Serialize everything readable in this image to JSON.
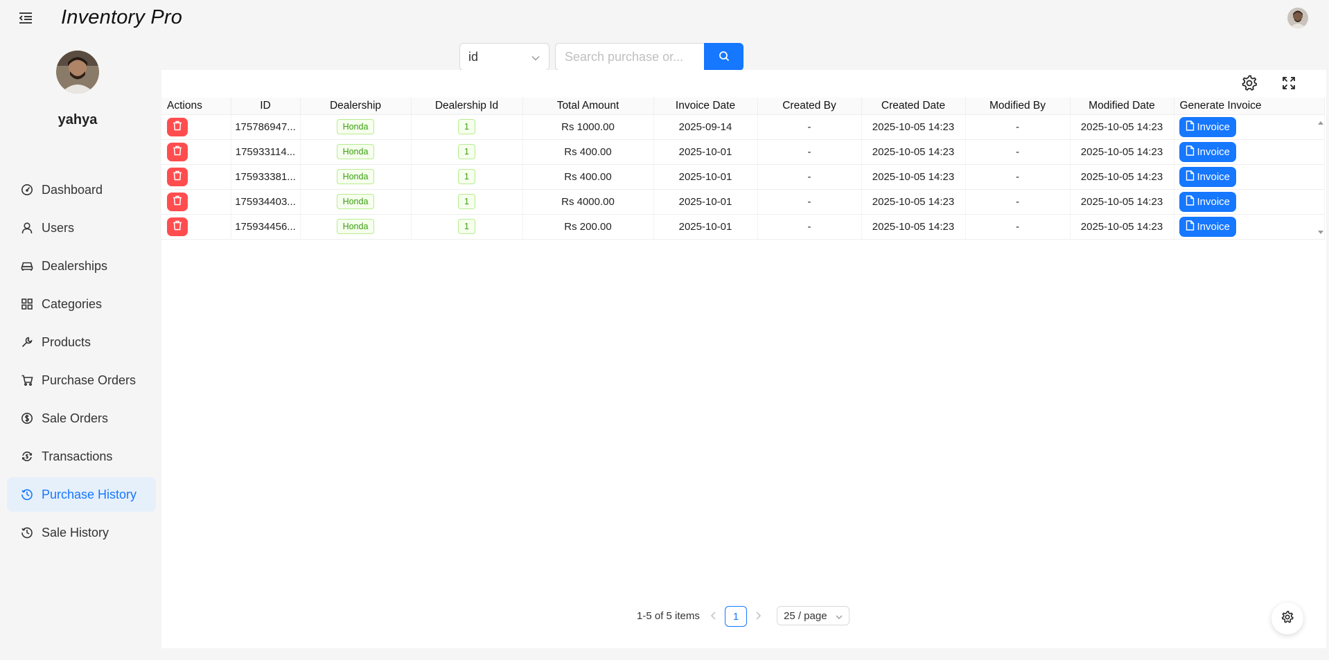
{
  "header": {
    "title": "Inventory Pro"
  },
  "sidebar": {
    "user_name": "yahya",
    "items": [
      {
        "label": "Dashboard",
        "icon": "dashboard-icon"
      },
      {
        "label": "Users",
        "icon": "user-icon"
      },
      {
        "label": "Dealerships",
        "icon": "car-icon"
      },
      {
        "label": "Categories",
        "icon": "grid-icon"
      },
      {
        "label": "Products",
        "icon": "tool-icon"
      },
      {
        "label": "Purchase Orders",
        "icon": "cart-icon"
      },
      {
        "label": "Sale Orders",
        "icon": "dollar-circle-icon"
      },
      {
        "label": "Transactions",
        "icon": "transaction-icon"
      },
      {
        "label": "Purchase History",
        "icon": "history-icon",
        "active": true
      },
      {
        "label": "Sale History",
        "icon": "history-icon"
      }
    ]
  },
  "search": {
    "field_value": "id",
    "placeholder": "Search purchase or..."
  },
  "table": {
    "columns": [
      "Actions",
      "ID",
      "Dealership",
      "Dealership Id",
      "Total Amount",
      "Invoice Date",
      "Created By",
      "Created Date",
      "Modified By",
      "Modified Date",
      "Generate Invoice"
    ],
    "rows": [
      {
        "id": "175786947...",
        "dealership": "Honda",
        "dealership_id": "1",
        "total_amount": "Rs 1000.00",
        "invoice_date": "2025-09-14",
        "created_by": "-",
        "created_date": "2025-10-05 14:23",
        "modified_by": "-",
        "modified_date": "2025-10-05 14:23",
        "invoice_label": "Invoice"
      },
      {
        "id": "175933114...",
        "dealership": "Honda",
        "dealership_id": "1",
        "total_amount": "Rs 400.00",
        "invoice_date": "2025-10-01",
        "created_by": "-",
        "created_date": "2025-10-05 14:23",
        "modified_by": "-",
        "modified_date": "2025-10-05 14:23",
        "invoice_label": "Invoice"
      },
      {
        "id": "175933381...",
        "dealership": "Honda",
        "dealership_id": "1",
        "total_amount": "Rs 400.00",
        "invoice_date": "2025-10-01",
        "created_by": "-",
        "created_date": "2025-10-05 14:23",
        "modified_by": "-",
        "modified_date": "2025-10-05 14:23",
        "invoice_label": "Invoice"
      },
      {
        "id": "175934403...",
        "dealership": "Honda",
        "dealership_id": "1",
        "total_amount": "Rs 4000.00",
        "invoice_date": "2025-10-01",
        "created_by": "-",
        "created_date": "2025-10-05 14:23",
        "modified_by": "-",
        "modified_date": "2025-10-05 14:23",
        "invoice_label": "Invoice"
      },
      {
        "id": "175934456...",
        "dealership": "Honda",
        "dealership_id": "1",
        "total_amount": "Rs 200.00",
        "invoice_date": "2025-10-01",
        "created_by": "-",
        "created_date": "2025-10-05 14:23",
        "modified_by": "-",
        "modified_date": "2025-10-05 14:23",
        "invoice_label": "Invoice"
      }
    ]
  },
  "pagination": {
    "total_text": "1-5 of 5 items",
    "current_page": "1",
    "page_size": "25 / page"
  },
  "colors": {
    "primary": "#1677ff",
    "danger": "#ff4d4f",
    "tag_green": "#389e0d",
    "active_nav_bg": "#e6f0fb"
  }
}
